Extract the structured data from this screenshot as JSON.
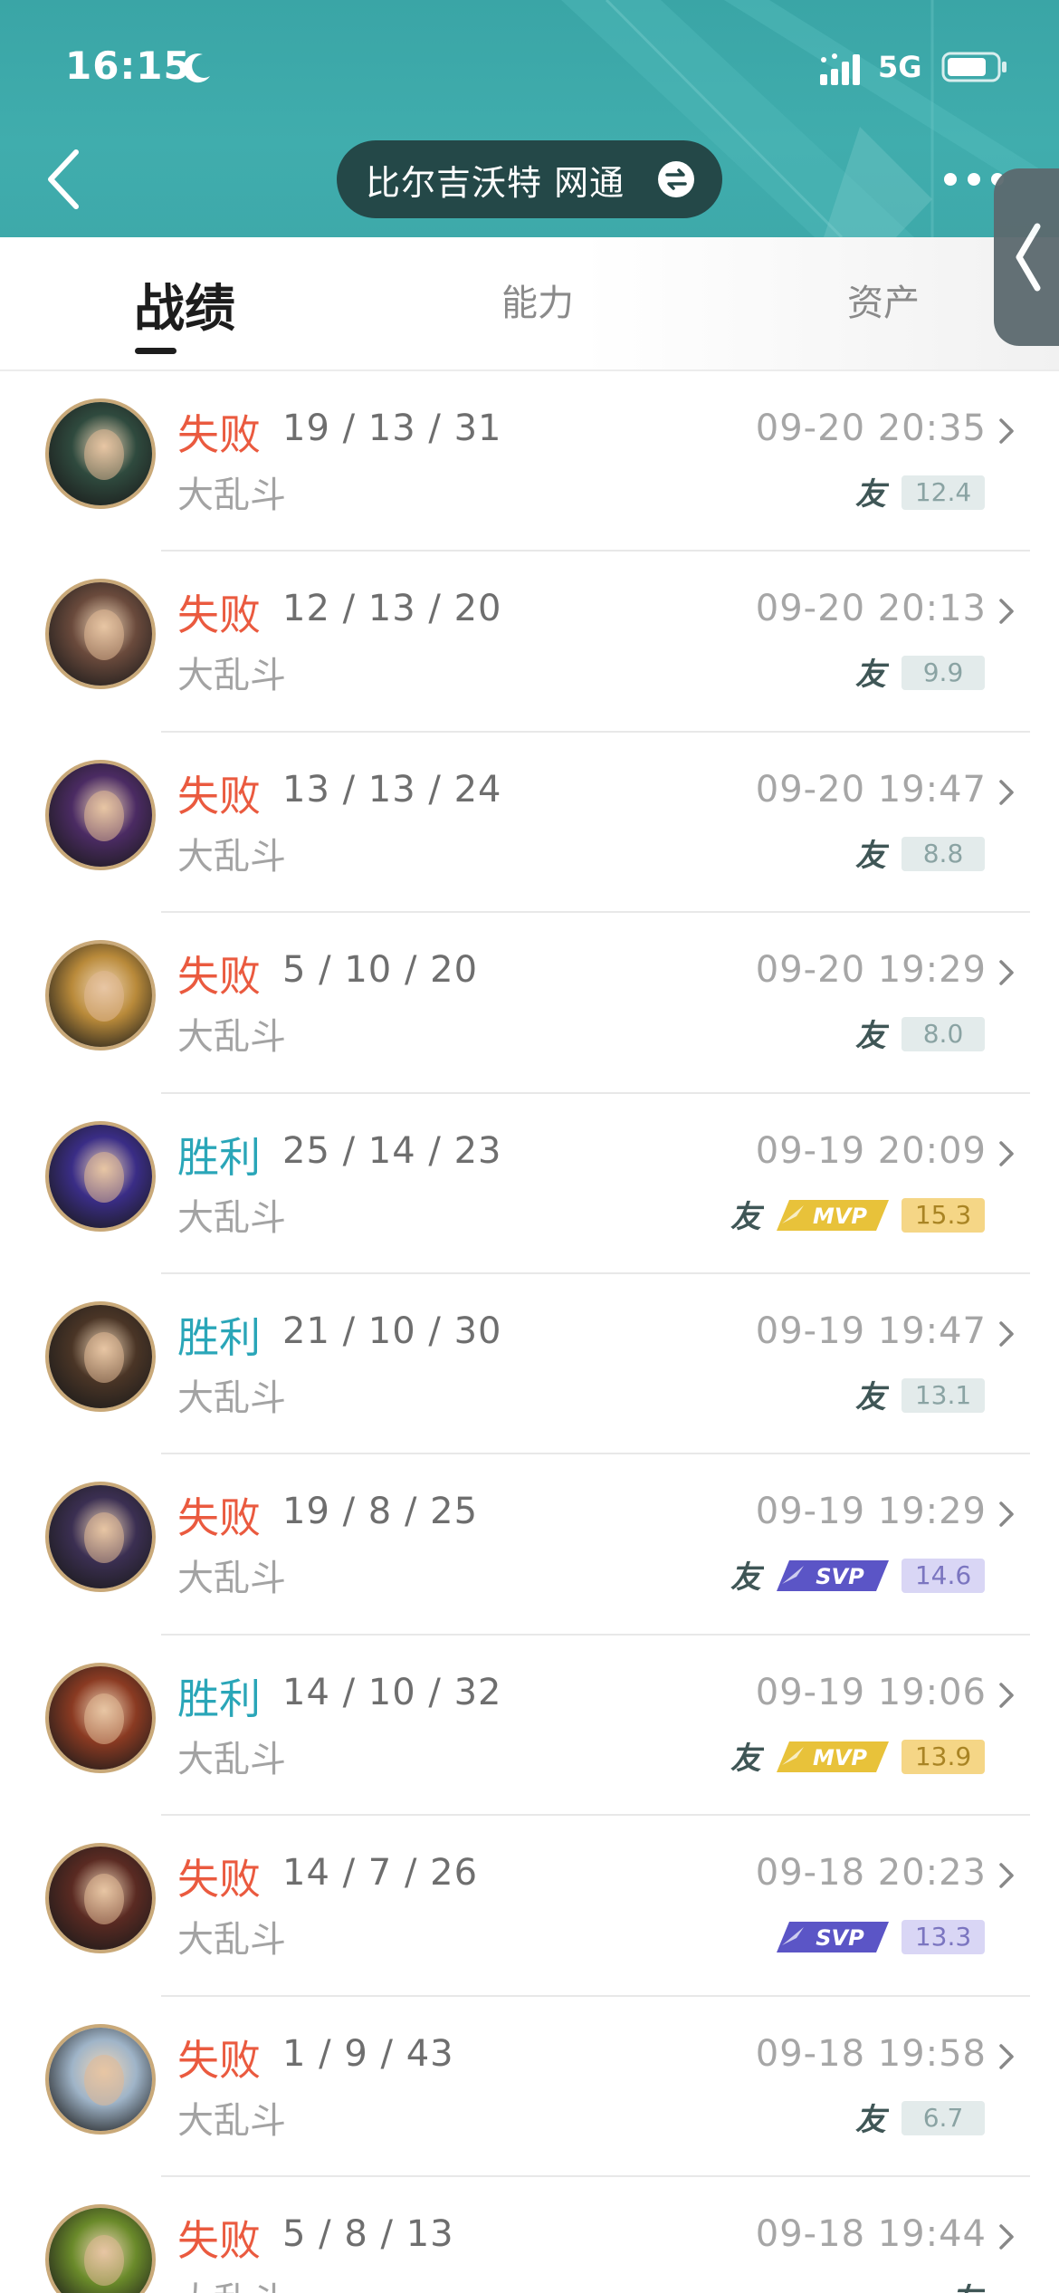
{
  "status_bar": {
    "time": "16:15",
    "network": "5G"
  },
  "header": {
    "account_name": "比尔吉沃特 网通"
  },
  "tabs": [
    {
      "label": "战绩",
      "active": true
    },
    {
      "label": "能力",
      "active": false
    },
    {
      "label": "资产",
      "active": false
    }
  ],
  "colors": {
    "header_bg": "#3ea9aa",
    "loss": "#ea5a3f",
    "win": "#2aa6b8",
    "mvp": "#f5d686",
    "svp": "#d9d6f5"
  },
  "matches": [
    {
      "result": "失败",
      "outcome": "lose",
      "kda": "19 / 13 / 31",
      "mode": "大乱斗",
      "time": "09-20 20:35",
      "friend": true,
      "badge": "",
      "score": "12.4",
      "avatar_color": "#2f4a3e"
    },
    {
      "result": "失败",
      "outcome": "lose",
      "kda": "12 / 13 / 20",
      "mode": "大乱斗",
      "time": "09-20 20:13",
      "friend": true,
      "badge": "",
      "score": "9.9",
      "avatar_color": "#6a4a3c"
    },
    {
      "result": "失败",
      "outcome": "lose",
      "kda": "13 / 13 / 24",
      "mode": "大乱斗",
      "time": "09-20 19:47",
      "friend": true,
      "badge": "",
      "score": "8.8",
      "avatar_color": "#4b2b63"
    },
    {
      "result": "失败",
      "outcome": "lose",
      "kda": "5 / 10 / 20",
      "mode": "大乱斗",
      "time": "09-20 19:29",
      "friend": true,
      "badge": "",
      "score": "8.0",
      "avatar_color": "#b98a3a"
    },
    {
      "result": "胜利",
      "outcome": "win",
      "kda": "25 / 14 / 23",
      "mode": "大乱斗",
      "time": "09-19 20:09",
      "friend": true,
      "badge": "MVP",
      "score": "15.3",
      "avatar_color": "#3a2d86"
    },
    {
      "result": "胜利",
      "outcome": "win",
      "kda": "21 / 10 / 30",
      "mode": "大乱斗",
      "time": "09-19 19:47",
      "friend": true,
      "badge": "",
      "score": "13.1",
      "avatar_color": "#4a3526"
    },
    {
      "result": "失败",
      "outcome": "lose",
      "kda": "19 / 8 / 25",
      "mode": "大乱斗",
      "time": "09-19 19:29",
      "friend": true,
      "badge": "SVP",
      "score": "14.6",
      "avatar_color": "#3b2f52"
    },
    {
      "result": "胜利",
      "outcome": "win",
      "kda": "14 / 10 / 32",
      "mode": "大乱斗",
      "time": "09-19 19:06",
      "friend": true,
      "badge": "MVP",
      "score": "13.9",
      "avatar_color": "#8a3a22"
    },
    {
      "result": "失败",
      "outcome": "lose",
      "kda": "14 / 7 / 26",
      "mode": "大乱斗",
      "time": "09-18 20:23",
      "friend": false,
      "badge": "SVP",
      "score": "13.3",
      "avatar_color": "#5a2a22"
    },
    {
      "result": "失败",
      "outcome": "lose",
      "kda": "1 / 9 / 43",
      "mode": "大乱斗",
      "time": "09-18 19:58",
      "friend": true,
      "badge": "",
      "score": "6.7",
      "avatar_color": "#9fb4c8"
    },
    {
      "result": "失败",
      "outcome": "lose",
      "kda": "5 / 8 / 13",
      "mode": "大乱斗",
      "time": "09-18 19:44",
      "friend": true,
      "badge": "",
      "score": "",
      "avatar_color": "#6a8a2a"
    }
  ],
  "icons": {
    "friend_glyph": "友",
    "mvp_label": "MVP",
    "svp_label": "SVP"
  }
}
